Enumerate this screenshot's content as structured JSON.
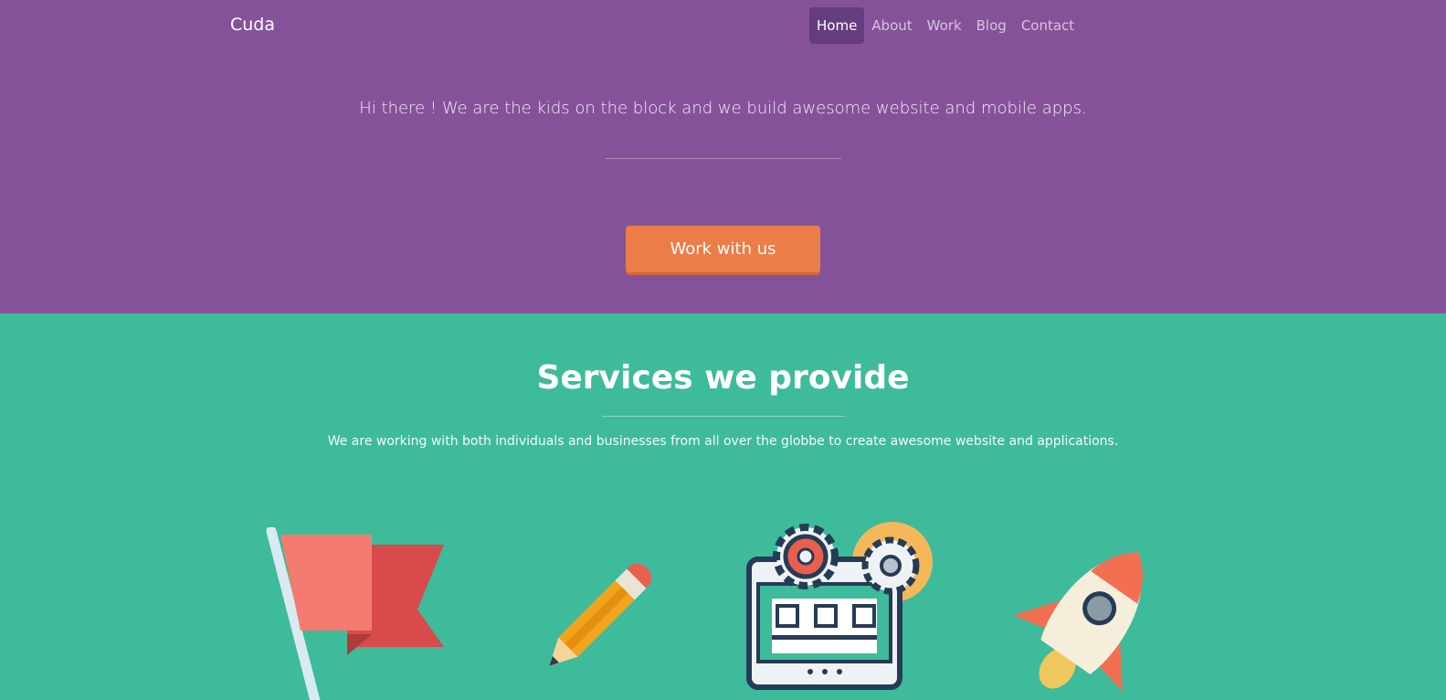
{
  "header": {
    "brand": "Cuda",
    "nav": [
      {
        "label": "Home",
        "active": true
      },
      {
        "label": "About",
        "active": false
      },
      {
        "label": "Work",
        "active": false
      },
      {
        "label": "Blog",
        "active": false
      },
      {
        "label": "Contact",
        "active": false
      }
    ]
  },
  "hero": {
    "tagline": "Hi there ! We are the kids on the block and we build awesome website and mobile apps.",
    "cta_label": "Work with us",
    "background": "#85529a",
    "cta_color": "#ec7c48"
  },
  "services": {
    "title": "Services we provide",
    "description": "We are working with both individuals and businesses from all over the globbe to create awesome website and applications.",
    "background": "#3dbb9b",
    "icons": [
      "flag-icon",
      "pencil-icon",
      "computer-gears-icon",
      "rocket-icon"
    ]
  }
}
